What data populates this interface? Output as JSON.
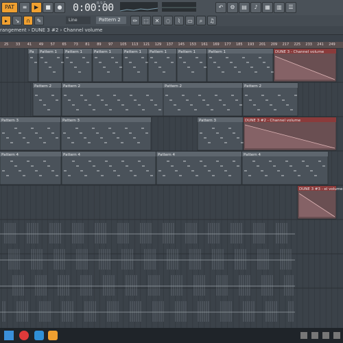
{
  "toolbar": {
    "time": "0:00:00",
    "time_units": "B:S:T",
    "tempo": "",
    "icons": [
      "menu-icon",
      "play-icon",
      "stop-icon",
      "record-icon",
      "song-mode-icon",
      "metronome-icon",
      "loop-icon",
      "snap-icon"
    ]
  },
  "toolbar2": {
    "snap_mode": "Line",
    "pattern_selector": "Pattern 2"
  },
  "breadcrumb": {
    "text": "rangement › DUNE 3 #2 › Channel volume"
  },
  "ruler": {
    "marks": [
      "25",
      "33",
      "41",
      "49",
      "57",
      "65",
      "73",
      "81",
      "89",
      "97",
      "105",
      "113",
      "121",
      "129",
      "137",
      "145",
      "153",
      "161",
      "169",
      "177",
      "185",
      "193",
      "201",
      "209",
      "217",
      "225",
      "233",
      "241",
      "249"
    ]
  },
  "tracks": [
    {
      "row": 1,
      "clips": [
        {
          "label": "Pa"
        },
        {
          "label": "Pattern 1"
        },
        {
          "label": "Pattern 1"
        },
        {
          "label": "Pattern 1"
        },
        {
          "label": "Pattern 1"
        },
        {
          "label": "Pattern 1"
        },
        {
          "label": "Pattern 1"
        },
        {
          "label": "Pattern 1"
        },
        {
          "label": "DUNE 3 - Channel volume"
        }
      ]
    },
    {
      "row": 2,
      "clips": [
        {
          "label": "Pattern 2"
        },
        {
          "label": "Pattern 2"
        },
        {
          "label": "Pattern 2"
        },
        {
          "label": "Pattern 2"
        }
      ]
    },
    {
      "row": 3,
      "clips": [
        {
          "label": "Pattern 3"
        },
        {
          "label": "Pattern 3"
        },
        {
          "label": "Pattern 3"
        },
        {
          "label": "DUNE 3 #2 - Channel volume"
        }
      ]
    },
    {
      "row": 4,
      "clips": [
        {
          "label": "Pattern 4"
        },
        {
          "label": "Pattern 4"
        },
        {
          "label": "Pattern 4"
        },
        {
          "label": "Pattern 4"
        }
      ]
    },
    {
      "row": 5,
      "clips": [
        {
          "label": "DUNE 3 #3 - el volume"
        }
      ]
    }
  ],
  "colors": {
    "clip_bg": "#4a525a",
    "clip_header": "#5e666e",
    "automation_header": "#8a3b3b",
    "automation_fill": "#6a4f52",
    "accent": "#f0a030"
  }
}
